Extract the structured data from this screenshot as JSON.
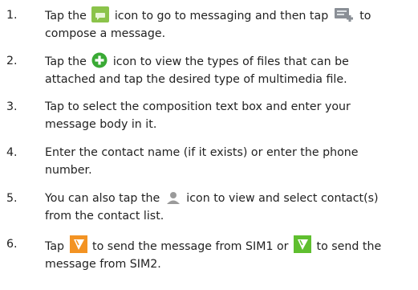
{
  "steps": [
    {
      "number": "1.",
      "parts": [
        "Tap the",
        "icon to go to messaging and then tap",
        "to",
        "compose a message."
      ],
      "icons": [
        "messaging-icon",
        "compose-icon"
      ]
    },
    {
      "number": "2.",
      "parts": [
        "Tap the",
        "icon to view the types of files that can be",
        "attached and tap the desired type of multimedia file."
      ],
      "icons": [
        "add-attachment-icon"
      ]
    },
    {
      "number": "3.",
      "parts": [
        "Tap to select the composition text box and enter your",
        "message body in it."
      ]
    },
    {
      "number": "4.",
      "parts": [
        "Enter the contact name (if it exists) or enter the phone",
        "number."
      ]
    },
    {
      "number": "5.",
      "parts": [
        "You can also tap the",
        "icon to view and select contact(s)",
        "from the contact list."
      ],
      "icons": [
        "contacts-icon"
      ]
    },
    {
      "number": "6.",
      "parts": [
        "Tap",
        "to send the message from SIM1 or",
        "to send the",
        "message from SIM2."
      ],
      "icons": [
        "send-sim1-icon",
        "send-sim2-icon"
      ]
    }
  ],
  "colors": {
    "text": "#222222",
    "messaging_icon": "#8bc34a",
    "compose_icon": "#8a8f96",
    "add_icon": "#3aaa35",
    "contacts_icon": "#9a9a9a",
    "sim1_send": "#f39323",
    "sim2_send": "#5fbf2f"
  }
}
